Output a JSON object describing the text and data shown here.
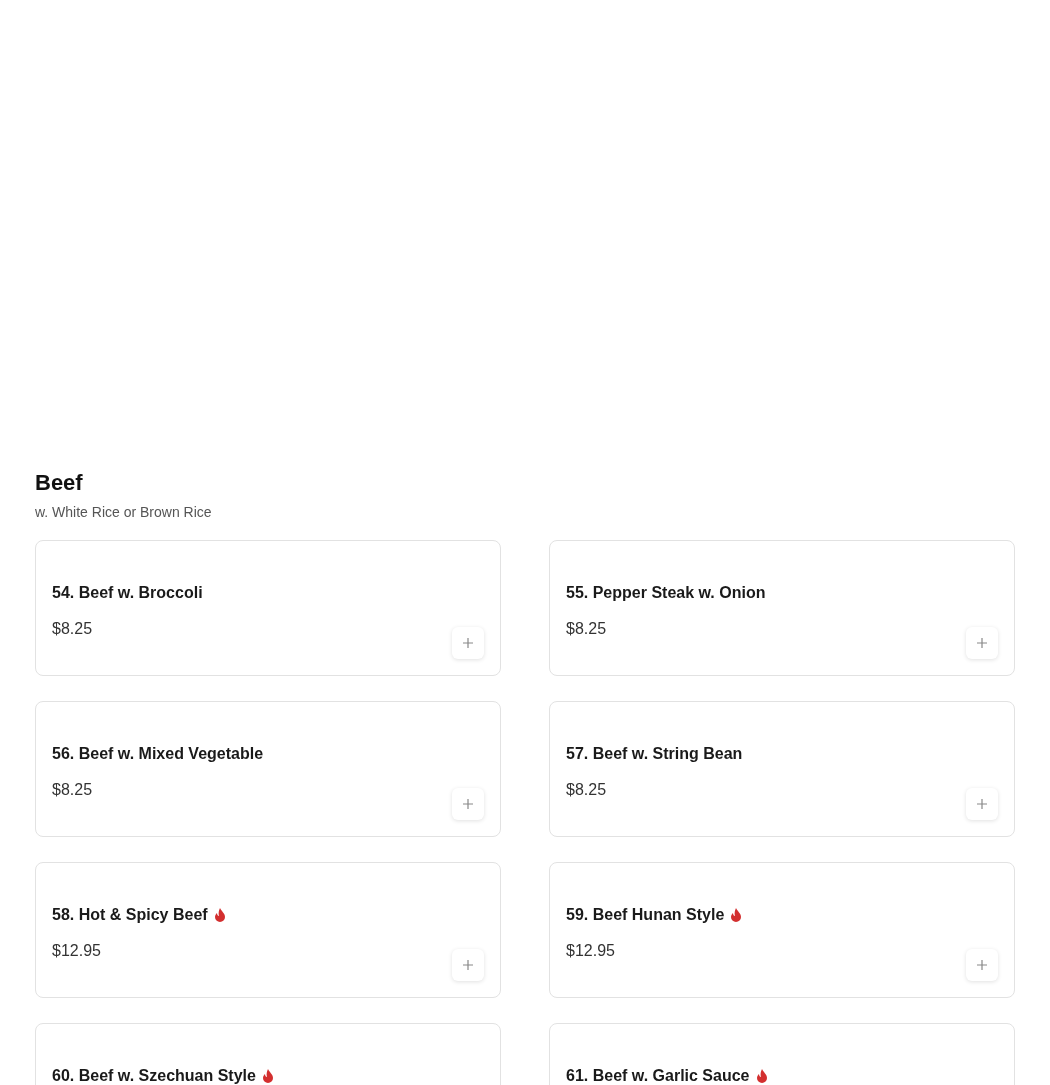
{
  "section": {
    "title": "Beef",
    "subtitle": "w. White Rice or Brown Rice"
  },
  "items": [
    {
      "name": "54. Beef w. Broccoli",
      "price": "$8.25",
      "spicy": false
    },
    {
      "name": "55. Pepper Steak w. Onion",
      "price": "$8.25",
      "spicy": false
    },
    {
      "name": "56. Beef w. Mixed Vegetable",
      "price": "$8.25",
      "spicy": false
    },
    {
      "name": "57. Beef w. String Bean",
      "price": "$8.25",
      "spicy": false
    },
    {
      "name": "58. Hot & Spicy Beef",
      "price": "$12.95",
      "spicy": true
    },
    {
      "name": "59. Beef Hunan Style",
      "price": "$12.95",
      "spicy": true
    },
    {
      "name": "60. Beef w. Szechuan Style",
      "spicy": true
    },
    {
      "name": "61. Beef w. Garlic Sauce",
      "spicy": true
    }
  ]
}
